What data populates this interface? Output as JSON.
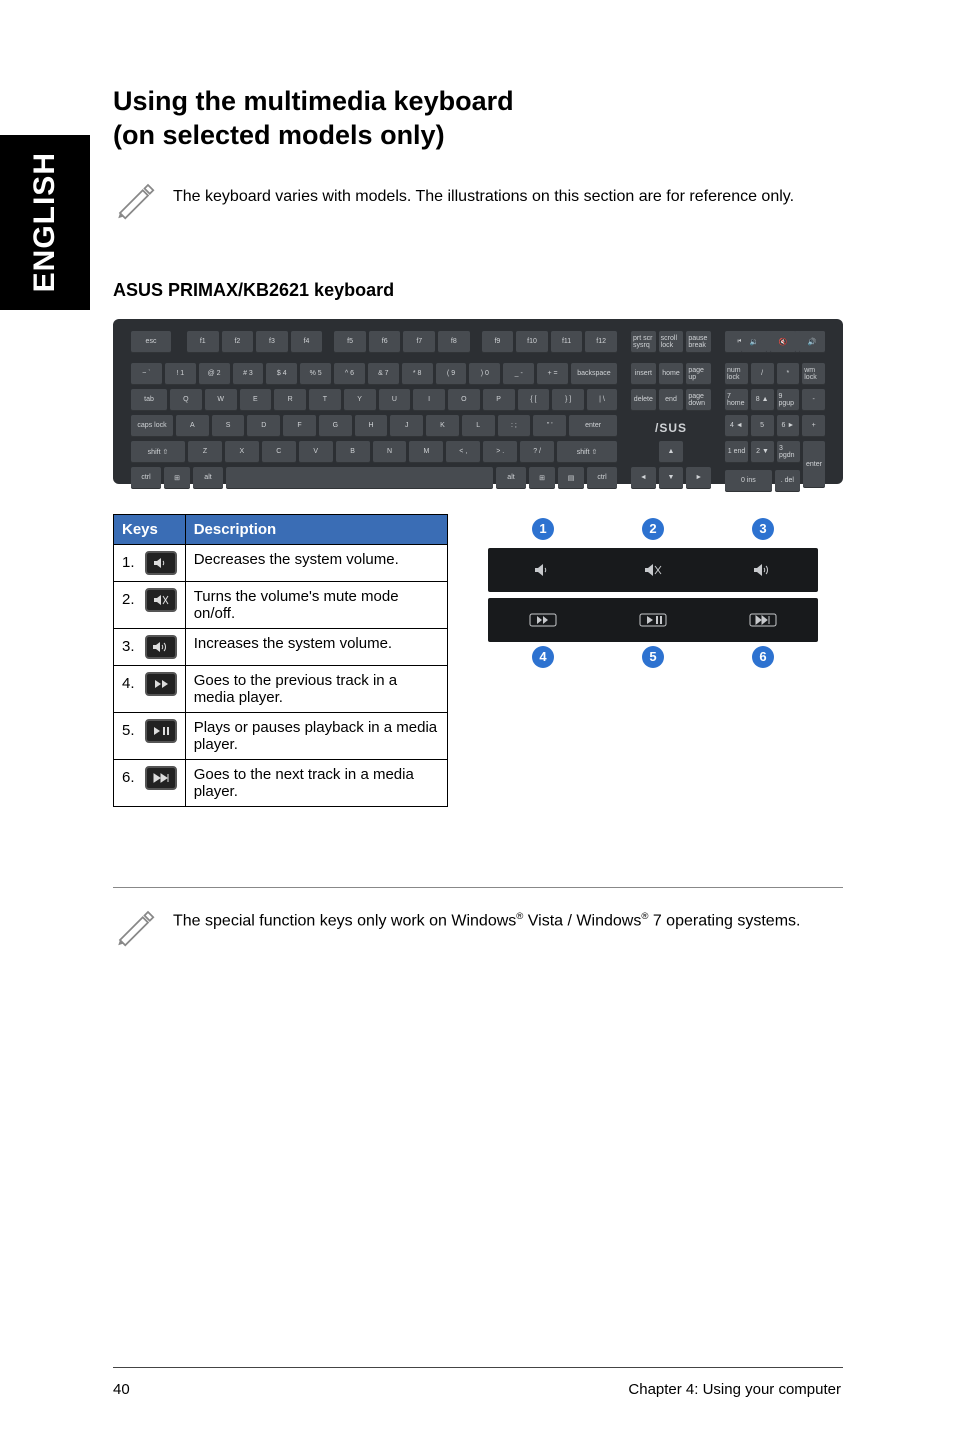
{
  "sidebar": {
    "label": "ENGLISH"
  },
  "heading": {
    "line1": "Using the multimedia keyboard",
    "line2": "(on selected models only)"
  },
  "note1": "The keyboard varies with models. The illustrations on this section are for reference only.",
  "subheading": "ASUS PRIMAX/KB2621 keyboard",
  "kb": {
    "esc": "esc",
    "fkeys": [
      "f1",
      "f2",
      "f3",
      "f4",
      "f5",
      "f6",
      "f7",
      "f8",
      "f9",
      "f10",
      "f11",
      "f12"
    ],
    "sys": [
      "prt scr\nsysrq",
      "scroll\nlock",
      "pause\nbreak"
    ],
    "numrow": [
      "~\n`",
      "!\n1",
      "@\n2",
      "#\n3",
      "$\n4",
      "%\n5",
      "^\n6",
      "&\n7",
      "*\n8",
      "(\n9",
      ")\n0",
      "_\n-",
      "+\n="
    ],
    "backspace": "backspace",
    "nav1": [
      "insert",
      "home",
      "page\nup"
    ],
    "tab": "tab",
    "row2": [
      "Q",
      "W",
      "E",
      "R",
      "T",
      "Y",
      "U",
      "I",
      "O",
      "P",
      "{\n[",
      "}\n]",
      "|\n\\"
    ],
    "nav2": [
      "delete",
      "end",
      "page\ndown"
    ],
    "caps": "caps lock",
    "row3": [
      "A",
      "S",
      "D",
      "F",
      "G",
      "H",
      "J",
      "K",
      "L",
      ":\n;",
      "\"\n'"
    ],
    "enter": "enter",
    "shift": "shift ⇧",
    "row4": [
      "Z",
      "X",
      "C",
      "V",
      "B",
      "N",
      "M",
      "<\n,",
      ">\n.",
      "?\n/"
    ],
    "shift2": "shift ⇧",
    "ctrl": "ctrl",
    "alt": "alt",
    "numpad_top": [
      "num\nlock",
      "/",
      "*",
      "wm\nlock"
    ],
    "numpad_r1": [
      "7\nhome",
      "8\n▲",
      "9\npgup",
      "-"
    ],
    "numpad_r2": [
      "4\n◄",
      "5",
      "6\n►",
      "+"
    ],
    "numpad_r3": [
      "1\nend",
      "2\n▼",
      "3\npgdn"
    ],
    "numpad_r4": [
      "0\nins",
      ".\ndel"
    ],
    "numpad_enter": "enter",
    "asus": "/SUS",
    "arrows": [
      "◄",
      "▼",
      "►",
      "▲"
    ]
  },
  "table": {
    "header": {
      "keys": "Keys",
      "desc": "Description"
    },
    "rows": [
      {
        "num": "1.",
        "icon": "volume-down-icon",
        "desc": "Decreases the system volume."
      },
      {
        "num": "2.",
        "icon": "mute-icon",
        "desc": "Turns the volume's mute mode on/off."
      },
      {
        "num": "3.",
        "icon": "volume-up-icon",
        "desc": "Increases the system volume."
      },
      {
        "num": "4.",
        "icon": "prev-track-icon",
        "desc": "Goes to the previous track in a media player."
      },
      {
        "num": "5.",
        "icon": "play-pause-icon",
        "desc": "Plays or pauses playback in a media player."
      },
      {
        "num": "6.",
        "icon": "next-track-icon",
        "desc": "Goes to the next track in a media player."
      }
    ]
  },
  "diagram": {
    "top": [
      "1",
      "2",
      "3"
    ],
    "bottom": [
      "4",
      "5",
      "6"
    ]
  },
  "note2": {
    "pre": "The special function keys only work on Windows",
    "mid": " Vista / Windows",
    "post": " 7 operating systems."
  },
  "footer": {
    "page": "40",
    "chapter": "Chapter 4: Using your computer"
  }
}
